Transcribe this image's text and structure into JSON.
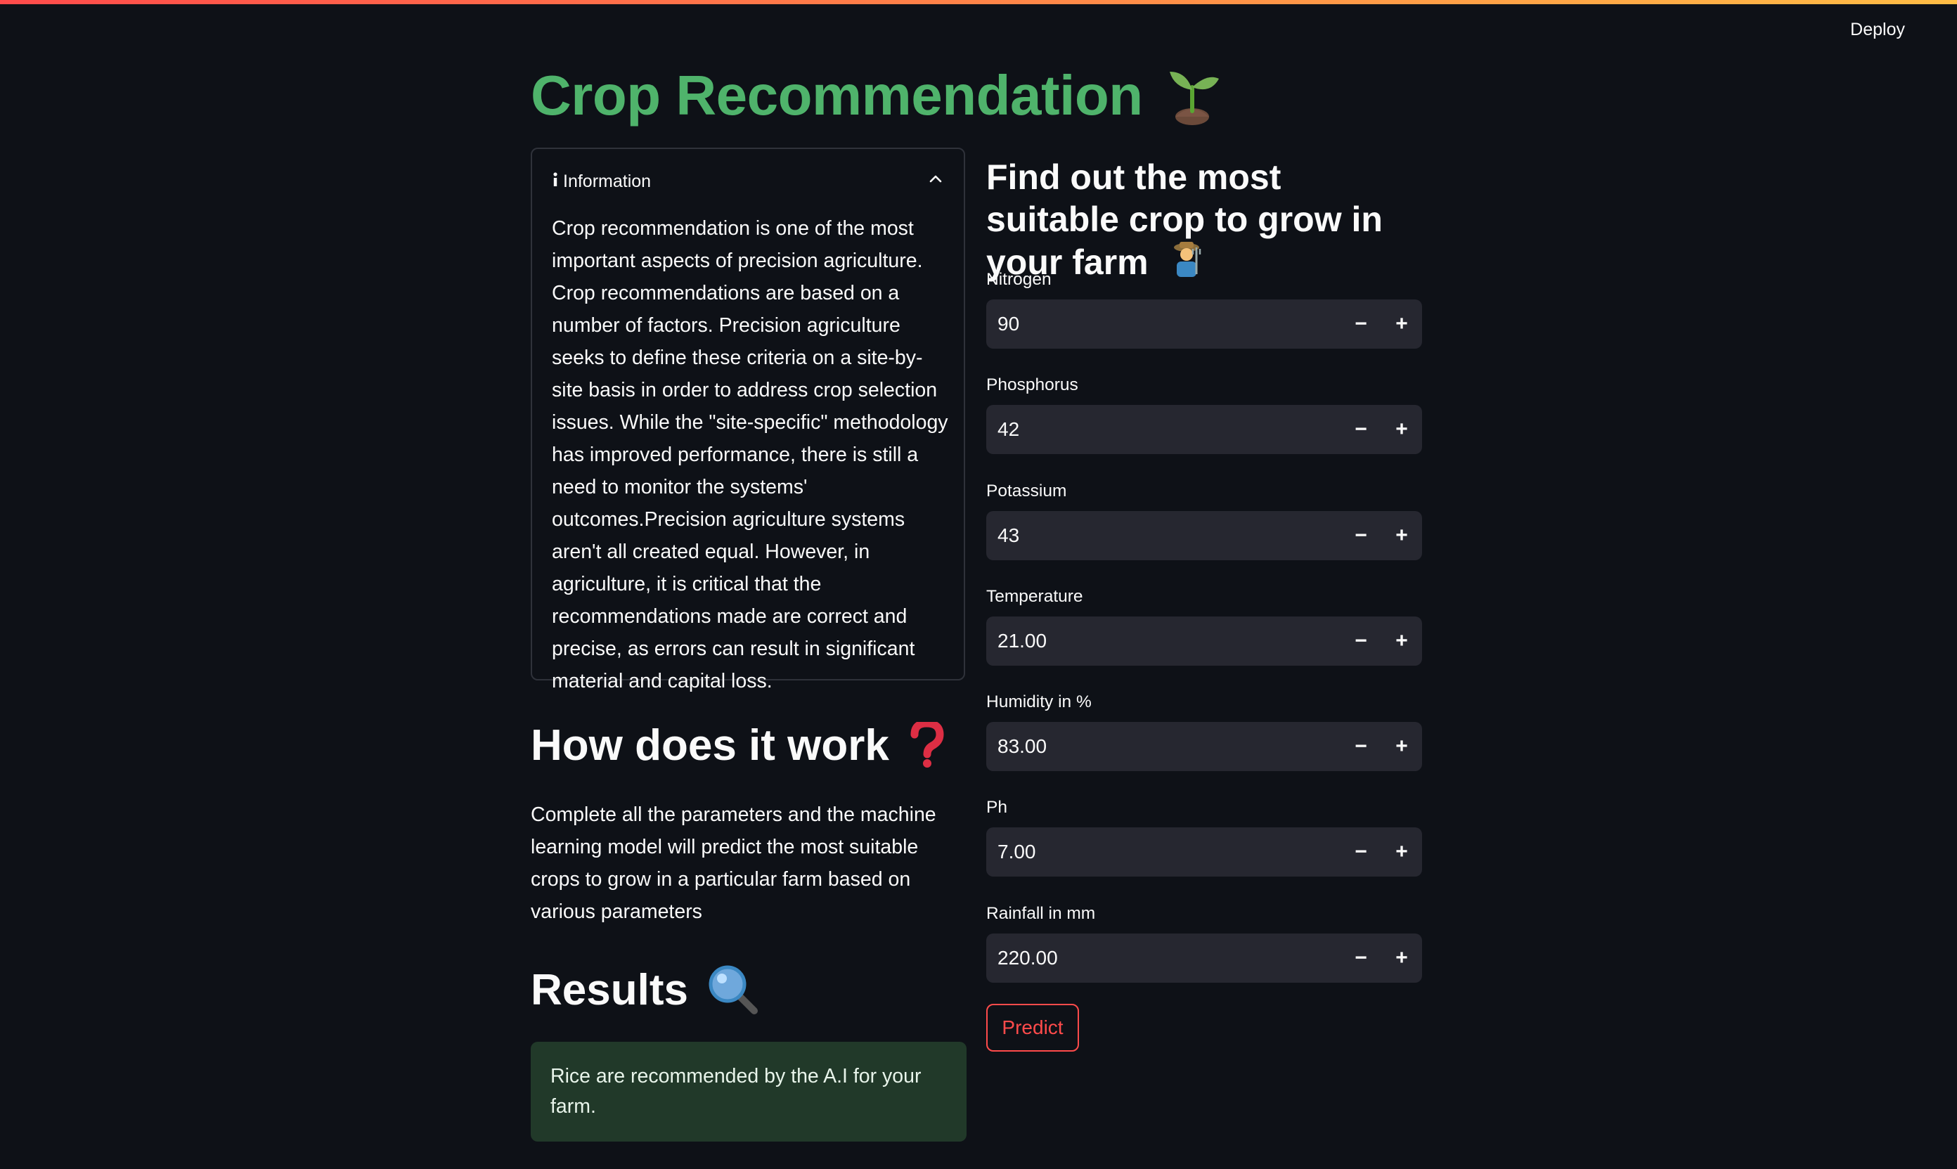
{
  "header": {
    "deploy_label": "Deploy"
  },
  "title": "Crop Recommendation",
  "info": {
    "label": "Information",
    "body": "Crop recommendation is one of the most important aspects of precision agriculture. Crop recommendations are based on a number of factors. Precision agriculture seeks to define these criteria on a site-by-site basis in order to address crop selection issues. While the \"site-specific\" methodology has improved performance, there is still a need to monitor the systems' outcomes.Precision agriculture systems aren't all created equal. However, in agriculture, it is critical that the recommendations made are correct and precise, as errors can result in significant material and capital loss."
  },
  "how": {
    "heading": "How does it work",
    "text": "Complete all the parameters and the machine learning model will predict the most suitable crops to grow in a particular farm based on various parameters"
  },
  "results": {
    "heading": "Results",
    "message": "Rice are recommended by the A.I for your farm."
  },
  "form": {
    "heading": "Find out the most suitable crop to grow in your farm",
    "fields": [
      {
        "label": "Nitrogen",
        "value": "90"
      },
      {
        "label": "Phosphorus",
        "value": "42"
      },
      {
        "label": "Potassium",
        "value": "43"
      },
      {
        "label": "Temperature",
        "value": "21.00"
      },
      {
        "label": "Humidity in %",
        "value": "83.00"
      },
      {
        "label": "Ph",
        "value": "7.00"
      },
      {
        "label": "Rainfall in mm",
        "value": "220.00"
      }
    ],
    "minus_label": "−",
    "plus_label": "+",
    "predict_label": "Predict"
  },
  "icons": {
    "title": "seedling-icon",
    "info": "info-icon",
    "collapse": "chevron-up-icon",
    "how": "question-mark-icon",
    "results": "magnifier-icon",
    "farmer": "farmer-icon"
  },
  "colors": {
    "background": "#0e1117",
    "title": "#4fb36b",
    "accent": "#ff4b4b",
    "input_bg": "#262730",
    "success_bg": "#213929"
  }
}
